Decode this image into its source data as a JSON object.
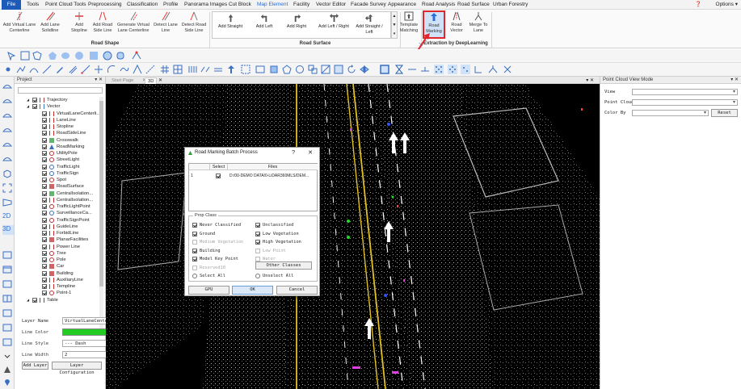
{
  "menu": {
    "items": [
      "File",
      "Tools",
      "Point Cloud Tools",
      "Preprocessing",
      "Classification",
      "Profile",
      "Panorama Images",
      "Cut Block",
      "Map Element",
      "Facility",
      "Vector Editor",
      "Facade Survey",
      "Appearance",
      "Road Analysis",
      "Road Surface",
      "Urban Forestry"
    ],
    "active": "Map Element",
    "options": "Options"
  },
  "ribbon": {
    "road_shape": {
      "label": "Road Shape",
      "buttons": [
        "Add Virtual Lane Centerline",
        "Add Lane Solidline",
        "Add Stopline",
        "Add Road Side Line",
        "Generate Virtual Lane Centerline",
        "Detect Lane Line",
        "Detect Road Side Line"
      ]
    },
    "road_surface": {
      "label": "Road Surface",
      "buttons": [
        "Add Straight",
        "Add Left",
        "Add Right",
        "Add Left / Right",
        "Add Straight / Left"
      ]
    },
    "template_matching": "Template Matching",
    "deeplearning": {
      "label": "Extraction by DeepLearning",
      "buttons": [
        "Road Marking",
        "Road Vector",
        "Merge To Lane"
      ]
    }
  },
  "project": {
    "title": "Project",
    "tree": [
      {
        "label": "Trajectory",
        "checked": true,
        "level": 1,
        "icon": "trajectory-icon",
        "color": "#b04040"
      },
      {
        "label": "Vector",
        "checked": true,
        "level": 1,
        "icon": "vector-icon",
        "color": "#3a6fc4"
      },
      {
        "label": "VirtualLaneCenterli...",
        "checked": true,
        "level": 2,
        "icon": "line-icon",
        "color": "#c03030"
      },
      {
        "label": "LaneLine",
        "checked": true,
        "level": 2,
        "icon": "line-icon",
        "color": "#c03030"
      },
      {
        "label": "Stopline",
        "checked": true,
        "level": 2,
        "icon": "line-icon",
        "color": "#c03030"
      },
      {
        "label": "RoadSideLine",
        "checked": true,
        "level": 2,
        "icon": "line-icon",
        "color": "#c03030"
      },
      {
        "label": "Crosswalk",
        "checked": true,
        "level": 2,
        "icon": "polygon-icon",
        "color": "#2e9c3c"
      },
      {
        "label": "RoadMarking",
        "checked": true,
        "level": 2,
        "icon": "arrow-icon",
        "color": "#3a6fc4"
      },
      {
        "label": "UtilityPole",
        "checked": true,
        "level": 2,
        "icon": "point-icon",
        "color": "#c03030"
      },
      {
        "label": "StreetLight",
        "checked": true,
        "level": 2,
        "icon": "point-icon",
        "color": "#c03030"
      },
      {
        "label": "TrafficLight",
        "checked": true,
        "level": 2,
        "icon": "point-icon",
        "color": "#3a6fc4"
      },
      {
        "label": "TrafficSign",
        "checked": true,
        "level": 2,
        "icon": "point-icon",
        "color": "#3a6fc4"
      },
      {
        "label": "Spot",
        "checked": true,
        "level": 2,
        "icon": "point-icon",
        "color": "#c03030"
      },
      {
        "label": "RoadSurface",
        "checked": true,
        "level": 2,
        "icon": "polygon-icon",
        "color": "#c03030"
      },
      {
        "label": "CentralIsolation...",
        "checked": true,
        "level": 2,
        "icon": "polygon-icon",
        "color": "#2e9c3c"
      },
      {
        "label": "CentralIsolation...",
        "checked": true,
        "level": 2,
        "icon": "line-icon",
        "color": "#c03030"
      },
      {
        "label": "TrafficLightPoint",
        "checked": true,
        "level": 2,
        "icon": "point-icon",
        "color": "#c03030"
      },
      {
        "label": "SurveillanceCa...",
        "checked": true,
        "level": 2,
        "icon": "point-icon",
        "color": "#3a6fc4"
      },
      {
        "label": "TrafficSignPoint",
        "checked": true,
        "level": 2,
        "icon": "point-icon",
        "color": "#c03030"
      },
      {
        "label": "GuideLine",
        "checked": true,
        "level": 2,
        "icon": "line-icon",
        "color": "#c03030"
      },
      {
        "label": "ForbidLine",
        "checked": true,
        "level": 2,
        "icon": "line-icon",
        "color": "#c03030"
      },
      {
        "label": "PlanarFacilities",
        "checked": true,
        "level": 2,
        "icon": "polygon-icon",
        "color": "#c03030"
      },
      {
        "label": "Power Line",
        "checked": true,
        "level": 2,
        "icon": "line-icon",
        "color": "#c03030"
      },
      {
        "label": "Tree",
        "checked": true,
        "level": 2,
        "icon": "point-icon",
        "color": "#c03030"
      },
      {
        "label": "Pole",
        "checked": true,
        "level": 2,
        "icon": "point-icon",
        "color": "#c03030"
      },
      {
        "label": "Car",
        "checked": true,
        "level": 2,
        "icon": "polygon-icon",
        "color": "#c03030"
      },
      {
        "label": "Building",
        "checked": true,
        "level": 2,
        "icon": "polygon-icon",
        "color": "#c03030"
      },
      {
        "label": "AuxiliaryLine",
        "checked": true,
        "level": 2,
        "icon": "line-icon",
        "color": "#c03030"
      },
      {
        "label": "Templine",
        "checked": true,
        "level": 2,
        "icon": "line-icon",
        "color": "#c03030"
      },
      {
        "label": "Point-1",
        "checked": true,
        "level": 2,
        "icon": "point-icon",
        "color": "#c03030"
      },
      {
        "label": "Table",
        "checked": true,
        "level": 1,
        "icon": "table-icon",
        "color": "#555555"
      }
    ],
    "layer_name_label": "Layer Name",
    "layer_name_value": "VirtualLaneCenterli",
    "line_color_label": "Line Color",
    "line_color_value": "#22cc22",
    "line_style_label": "Line Style",
    "line_style_value": "--- Dash",
    "line_width_label": "Line Width",
    "line_width_value": "2",
    "add_layer": "Add Layer",
    "layer_config": "Layer Configuration"
  },
  "tabs": [
    "Start Page",
    "3D"
  ],
  "pointcloud_panel": {
    "title": "Point Cloud View Mode",
    "view_label": "View",
    "pointcloud_label": "Point Cloud",
    "colorby_label": "Color By",
    "reset": "Reset"
  },
  "dialog": {
    "title": "Road Marking Batch Process",
    "help": "?",
    "close": "✕",
    "col_select": "Select",
    "col_files": "Files",
    "row_index": "1",
    "row_file": "D:/00-DEMO DATA/0-LiDAR360MLS/DEM...",
    "prop_class_title": "Prop Class",
    "classes": [
      {
        "label": "Never Classified",
        "checked": true,
        "enabled": true
      },
      {
        "label": "Unclassified",
        "checked": true,
        "enabled": true
      },
      {
        "label": "Ground",
        "checked": true,
        "enabled": true
      },
      {
        "label": "Low Vegetation",
        "checked": true,
        "enabled": true
      },
      {
        "label": "Medium Vegetation",
        "checked": false,
        "enabled": false
      },
      {
        "label": "High Vegetation",
        "checked": true,
        "enabled": true
      },
      {
        "label": "Building",
        "checked": true,
        "enabled": true
      },
      {
        "label": "Low Point",
        "checked": false,
        "enabled": false
      },
      {
        "label": "Model Key Point",
        "checked": true,
        "enabled": true
      },
      {
        "label": "Water",
        "checked": false,
        "enabled": false
      },
      {
        "label": "Reserved10",
        "checked": false,
        "enabled": false
      }
    ],
    "other_classes": "Other Classes",
    "select_all": "Select All",
    "unselect_all": "Unselect All",
    "gpu": "GPU",
    "ok": "OK",
    "cancel": "Cancel"
  },
  "colors": {
    "accent": "#2b6cd8",
    "highlight": "#e0252b",
    "file_tab": "#1e5bb8"
  }
}
